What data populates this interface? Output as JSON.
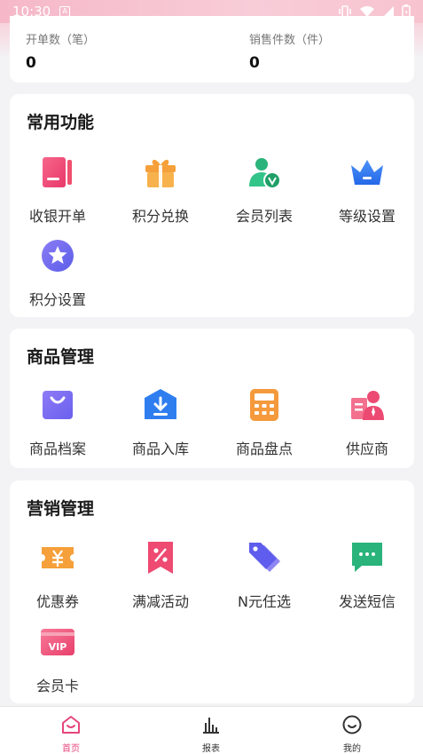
{
  "status_bar": {
    "time": "10:30"
  },
  "stats": {
    "orders_label": "开单数（笔）",
    "orders_value": "0",
    "sales_label": "销售件数（件）",
    "sales_value": "0"
  },
  "sections": {
    "common": {
      "title": "常用功能",
      "items": [
        "收银开单",
        "积分兑换",
        "会员列表",
        "等级设置",
        "积分设置"
      ]
    },
    "goods": {
      "title": "商品管理",
      "items": [
        "商品档案",
        "商品入库",
        "商品盘点",
        "供应商"
      ]
    },
    "marketing": {
      "title": "营销管理",
      "items": [
        "优惠券",
        "满减活动",
        "N元任选",
        "发送短信",
        "会员卡"
      ]
    }
  },
  "tabbar": {
    "items": [
      "首页",
      "报表",
      "我的"
    ],
    "active": "首页"
  },
  "colors": {
    "accent": "#e6457a",
    "pink_icon": "#f0506e",
    "orange_icon": "#f5a03a",
    "green_icon": "#2ab37a",
    "blue_icon": "#2f7ef0",
    "purple_icon": "#6b6ef2"
  }
}
